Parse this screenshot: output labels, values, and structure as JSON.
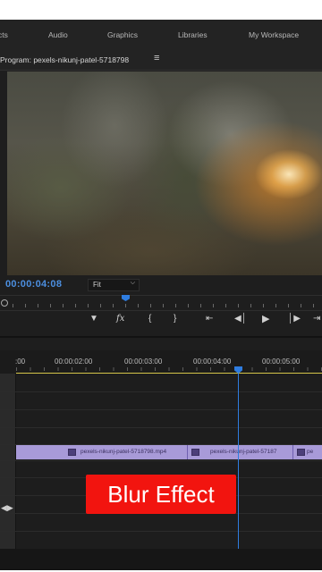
{
  "workspace_tabs": [
    {
      "label": "cts"
    },
    {
      "label": "Audio"
    },
    {
      "label": "Graphics"
    },
    {
      "label": "Libraries"
    },
    {
      "label": "My Workspace"
    }
  ],
  "program_monitor": {
    "title": "Program: pexels-nikunj-patel-5718798",
    "menu_icon": "≡",
    "timecode": "00:00:04:08",
    "fit_select": "Fit"
  },
  "transport_icons": [
    "marker-icon",
    "fx-icon",
    "mark-in-icon",
    "mark-out-icon",
    "go-to-in-icon",
    "step-back-icon",
    "play-icon",
    "step-forward-icon",
    "go-to-out-icon"
  ],
  "timeline": {
    "ruler_labels": [
      ":00",
      "00:00:02:00",
      "00:00:03:00",
      "00:00:04:00",
      "00:00:05:00"
    ],
    "clips": [
      {
        "label": "pexels-nikunj-patel-5718798.mp4"
      },
      {
        "label": "pexels-nikunj-patel-57187"
      },
      {
        "label": "pe"
      }
    ],
    "playhead_color": "#2f7de0",
    "clip_color": "#a89ad8"
  },
  "caption": {
    "text": "Blur Effect",
    "color": "#f2140f"
  }
}
